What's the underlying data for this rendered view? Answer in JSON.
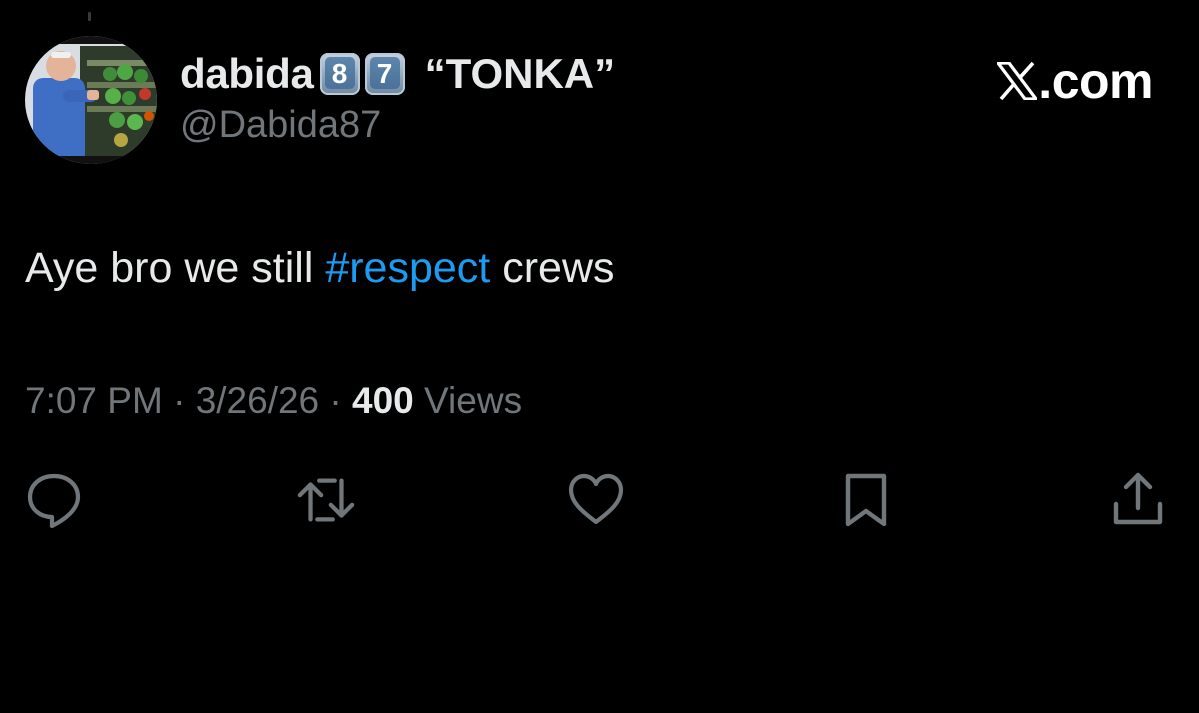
{
  "author": {
    "display_name": "dabida",
    "keycap_digits": [
      "8",
      "7"
    ],
    "nickname": "“TONKA”",
    "handle": "@Dabida87",
    "avatar_icon": "profile-photo"
  },
  "brand": {
    "logo_icon": "x-logo-icon",
    "text": ".com"
  },
  "tweet": {
    "text_before": "Aye bro we still ",
    "hashtag": "#respect",
    "text_after": " crews"
  },
  "meta": {
    "time": "7:07 PM",
    "separator": "·",
    "date": "3/26/26",
    "views_count": "400",
    "views_label": "Views"
  },
  "actions": [
    {
      "icon": "reply-icon"
    },
    {
      "icon": "retweet-icon"
    },
    {
      "icon": "like-icon"
    },
    {
      "icon": "bookmark-icon"
    },
    {
      "icon": "share-icon"
    }
  ],
  "colors": {
    "background": "#000000",
    "text_primary": "#e7e9ea",
    "text_secondary": "#71767b",
    "link": "#1d9bf0"
  }
}
